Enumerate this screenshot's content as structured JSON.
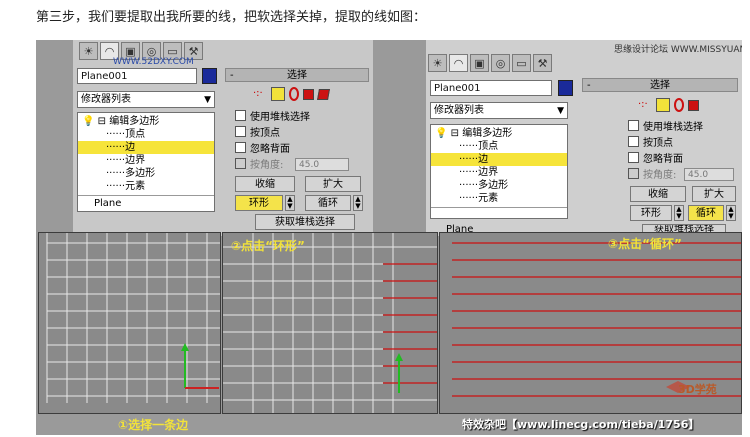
{
  "intro_text": "第三步，我们要提取出我所要的线，把软选择关掉，提取的线如图：",
  "watermark_left": "WWW.52DXY.COM",
  "watermark_right": "思缘设计论坛 WWW.MISSYUAN.COM",
  "object_name": "Plane001",
  "modifier_list": "修改器列表",
  "stack_items": [
    "编辑多边形",
    "顶点",
    "边",
    "边界",
    "多边形",
    "元素"
  ],
  "stack_selected": "边",
  "stack_base": "Plane",
  "rollout_title": "选择",
  "checks": {
    "by_vertex_stack": "使用堆栈选择",
    "by_vertex": "按顶点",
    "ignore_backfacing": "忽略背面",
    "by_angle": "按角度:",
    "angle_value": "45.0"
  },
  "buttons": {
    "shrink": "收缩",
    "grow": "扩大",
    "ring": "环形",
    "loop": "循环",
    "get_stack": "获取堆栈选择",
    "get_stack_partial": "获取堆栈选择"
  },
  "captions": {
    "step1": "①选择一条边",
    "step2": "②点击“环形”",
    "step3": "③点击“循环”"
  },
  "footer_text": "特效杂吧【www.linecg.com/tieba/1756】",
  "logo_text": "3D学苑",
  "colors": {
    "highlight": "#f6e43a",
    "selected_line": "#cc1111",
    "grid_line": "#e8e8e8",
    "caption": "#f2e23a"
  }
}
